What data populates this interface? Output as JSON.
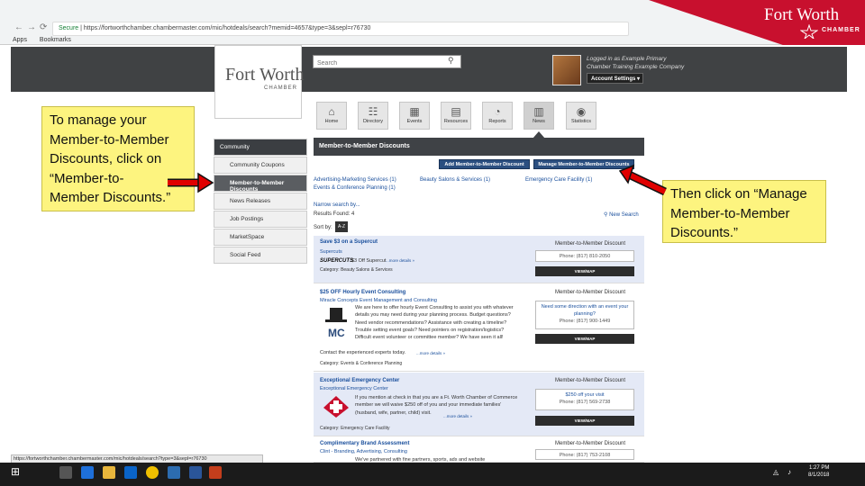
{
  "browser": {
    "secure": "Secure",
    "url": "https://fortworthchamber.chambermaster.com/mic/hotdeals/search?memid=4657&type=3&sepl=r76730",
    "bookmarks": [
      "Apps",
      "Bookmarks"
    ]
  },
  "brand": {
    "name": "Fort Worth",
    "sub": "CHAMBER"
  },
  "site": {
    "logo_name": "Fort Worth",
    "logo_sub": "CHAMBER",
    "search_placeholder": "Search",
    "user_logged": "Logged in as Example Primary",
    "user_company": "Chamber Training Example Company",
    "account_settings": "Account Settings",
    "tiles": [
      {
        "label": "Home",
        "icon": "⌂"
      },
      {
        "label": "Directory",
        "icon": "☷"
      },
      {
        "label": "Events",
        "icon": "▦"
      },
      {
        "label": "Resources",
        "icon": "▤"
      },
      {
        "label": "Reports",
        "icon": "◔"
      },
      {
        "label": "News",
        "icon": "▥"
      },
      {
        "label": "Statistics",
        "icon": "◉"
      }
    ]
  },
  "sidebar": {
    "items": [
      "Community",
      "Community Coupons",
      "Member-to-Member Discounts",
      "News Releases",
      "Job Postings",
      "MarketSpace",
      "Social Feed"
    ]
  },
  "content": {
    "heading": "Member-to-Member Discounts",
    "add_button": "Add Member-to-Member Discount",
    "manage_button": "Manage Member-to-Member Discounts",
    "categories": [
      "Advertising-Marketing Services (1)",
      "Beauty Salons & Services (1)",
      "Emergency Care Facility (1)",
      "Events & Conference Planning (1)"
    ],
    "narrow": "Narrow search by...",
    "results": "Results Found: 4",
    "new_search": "New Search",
    "sort_by": "Sort by:",
    "sort_az": "A-Z"
  },
  "listings": [
    {
      "title": "Save $3 on a Supercut",
      "company": "Supercuts",
      "logo": "SUPERCUTS",
      "text": "$3 Off Supercut",
      "more": "...more details »",
      "category": "Category: Beauty Salons & Services",
      "type": "Member-to-Member Discount",
      "box": [
        "Phone: (817) 810-2050"
      ],
      "view": "VIEW/MAP"
    },
    {
      "title": "$25 OFF Hourly Event Consulting",
      "company": "Miracle Concepts Event Management and Consulting",
      "text": [
        "We are here to offer hourly Event Consulting to assist you with whatever",
        "details you may need during your planning process. Budget questions?",
        "Need vendor recommendations? Assistance with creating a timeline?",
        "Trouble setting event goals? Need pointers on registration/logistics?",
        "Difficult event volunteer or committee member? We have seen it all!",
        "Contact the experienced experts today."
      ],
      "more": "...more details »",
      "category": "Category: Events & Conference Planning",
      "type": "Member-to-Member Discount",
      "box": [
        "Need some direction with an event your",
        "planning?",
        "Phone: (817) 900-1449"
      ],
      "view": "VIEW/MAP"
    },
    {
      "title": "Exceptional Emergency Center",
      "company": "Exceptional Emergency Center",
      "text": [
        "If you mention at check in that you are a Ft. Worth Chamber of Commerce",
        "member we will waive $250 off of you and your immediate families'",
        "(husband, wife, partner, child) visit."
      ],
      "more": "...more details »",
      "category": "Category: Emergency Care Facility",
      "type": "Member-to-Member Discount",
      "box": [
        "$250 off your visit",
        "Phone: (817) 569-2738"
      ],
      "view": "VIEW/MAP"
    },
    {
      "title": "Complimentary Brand Assessment",
      "company": "Clint - Branding, Advertising, Consulting",
      "text": [
        "We've partnered with fine partners, sports, ads and website"
      ],
      "type": "Member-to-Member Discount",
      "box": [
        "Phone: (817) 753-2108"
      ]
    }
  ],
  "status_url": "https://fortworthchamber.chambermaster.com/mic/hotdeals/search?type=3&sepl=r76730",
  "taskbar": {
    "time": "1:27 PM",
    "date": "8/1/2018"
  },
  "notes": {
    "left": [
      "To manage your",
      "Member-to-Member",
      "Discounts, click on",
      "“Member-to-",
      "Member Discounts.”"
    ],
    "right": [
      "Then click on “Manage",
      "Member-to-Member",
      "Discounts.”"
    ]
  },
  "colors": {
    "accent_red": "#c8102e",
    "note_yellow": "#fdf47f",
    "header_dark": "#404244",
    "link_blue": "#1a4f9c"
  }
}
